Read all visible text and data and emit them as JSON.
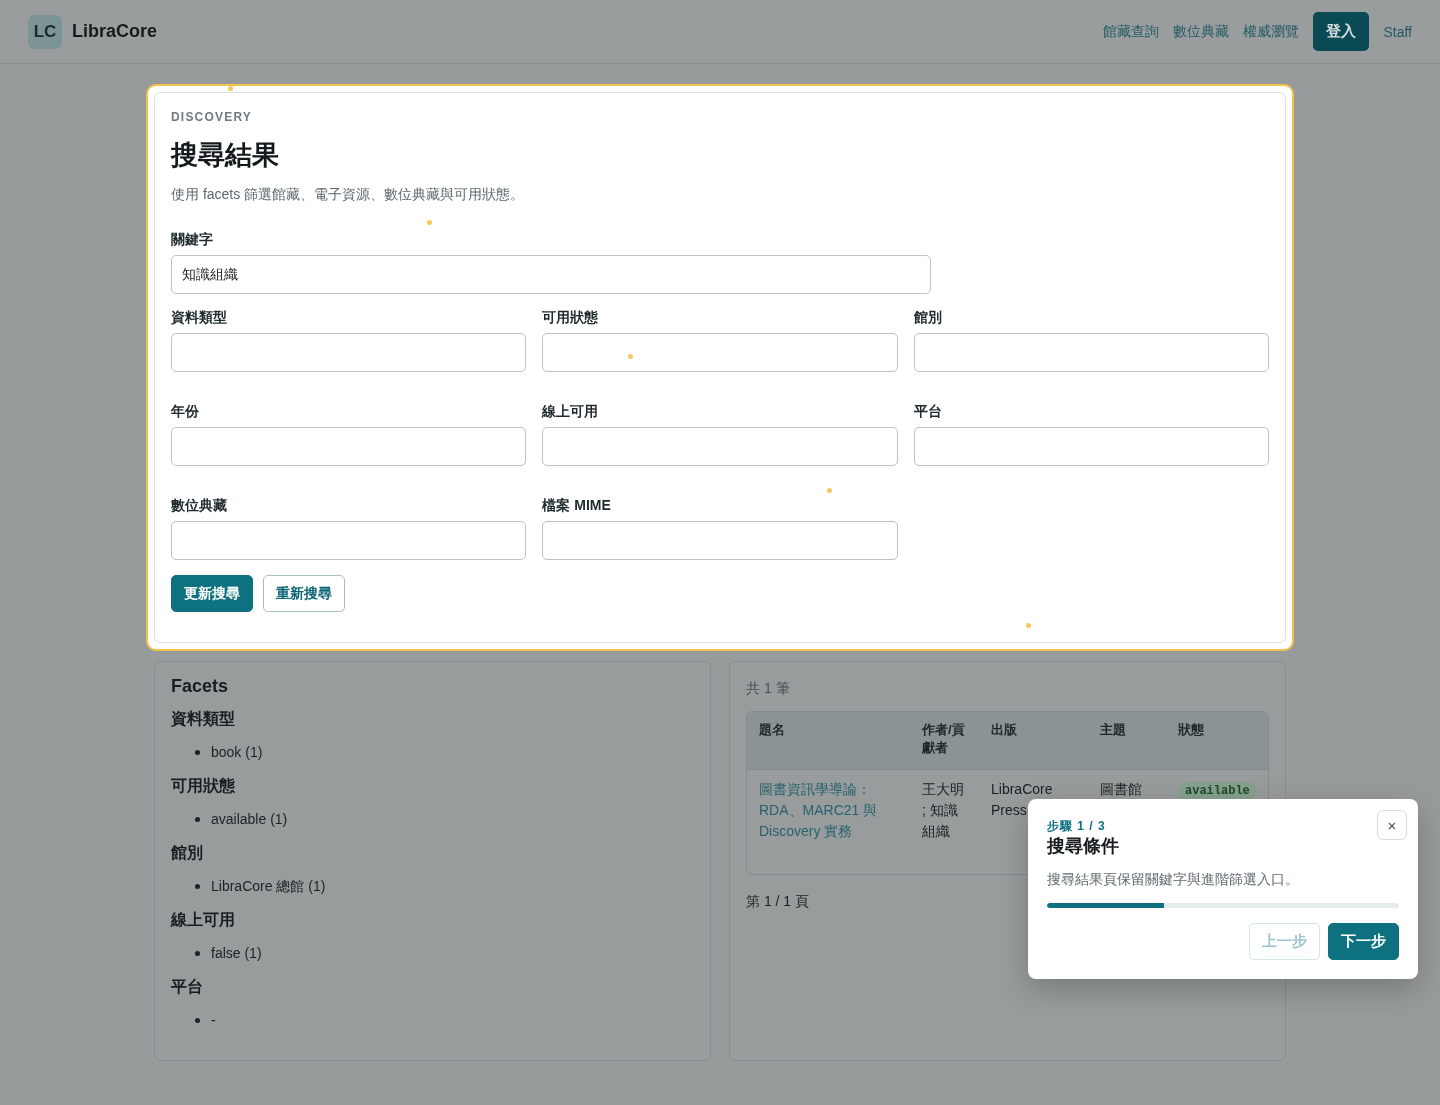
{
  "header": {
    "logo_mark": "LC",
    "brand": "LibraCore",
    "nav": [
      {
        "label": "館藏查詢",
        "kind": "link"
      },
      {
        "label": "數位典藏",
        "kind": "link"
      },
      {
        "label": "權威瀏覽",
        "kind": "link"
      },
      {
        "label": "登入",
        "kind": "button"
      },
      {
        "label": "Staff",
        "kind": "link"
      }
    ]
  },
  "search_panel": {
    "highlighted": true,
    "eyebrow": "DISCOVERY",
    "title": "搜尋結果",
    "subtitle": "使用 facets 篩選館藏、電子資源、數位典藏與可用狀態。",
    "keyword": {
      "label": "關鍵字",
      "value": "知識組織"
    },
    "filters": [
      {
        "label": "資料類型"
      },
      {
        "label": "可用狀態"
      },
      {
        "label": "館別"
      },
      {
        "label": "年份"
      },
      {
        "label": "線上可用"
      },
      {
        "label": "平台"
      },
      {
        "label": "數位典藏"
      },
      {
        "label": "檔案 MIME"
      }
    ],
    "buttons": [
      {
        "label": "更新搜尋",
        "kind": "primary"
      },
      {
        "label": "重新搜尋",
        "kind": "secondary"
      }
    ]
  },
  "facets": {
    "title": "Facets",
    "groups": [
      {
        "title": "資料類型",
        "items": [
          "book (1)"
        ]
      },
      {
        "title": "可用狀態",
        "items": [
          "available (1)"
        ]
      },
      {
        "title": "館別",
        "items": [
          "LibraCore 總館 (1)"
        ]
      },
      {
        "title": "線上可用",
        "items": [
          "false (1)"
        ]
      },
      {
        "title": "平台",
        "items": [
          "-"
        ]
      }
    ]
  },
  "results": {
    "count": "共 1 筆",
    "table": {
      "columns": [
        "題名",
        "作者/貢獻者",
        "出版",
        "主題",
        "狀態"
      ],
      "rows": [
        {
          "title": "圖書資訊學導論：RDA、MARC21 與 Discovery 實務",
          "contributors": "王大明 ; 知識組織",
          "publisher": "LibraCore Press",
          "subject": "圖書館",
          "status": "available"
        }
      ]
    },
    "pagination": "第 1 / 1 頁"
  },
  "tour": {
    "step": "步驟 1 / 3",
    "title": "搜尋條件",
    "body": "搜尋結果頁保留關鍵字與進階篩選入口。",
    "close": "×",
    "level": 0.333,
    "buttons": [
      {
        "label": "上一步",
        "kind": "secondary",
        "disabled": true
      },
      {
        "label": "下一步",
        "kind": "primary",
        "disabled": false
      }
    ]
  }
}
